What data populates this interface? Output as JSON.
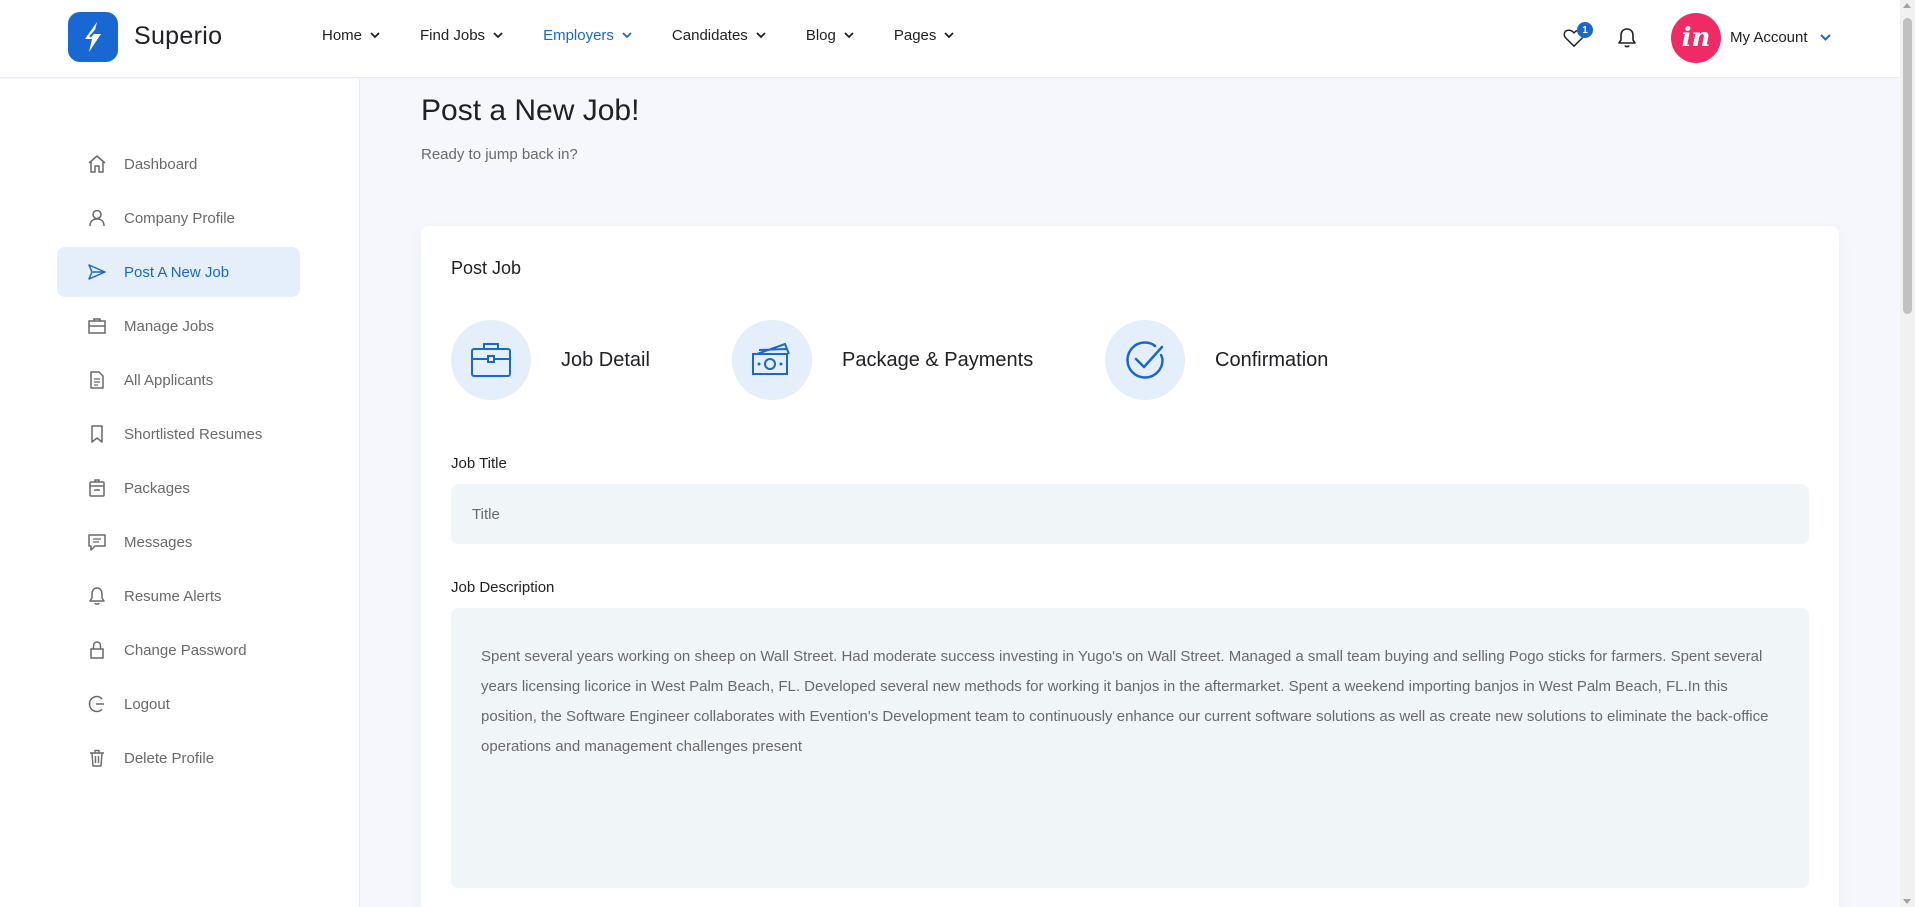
{
  "brand": {
    "name": "Superio",
    "logo_icon": "superio-logo-icon",
    "color": "#1967d2"
  },
  "nav": {
    "items": [
      {
        "label": "Home",
        "active": false
      },
      {
        "label": "Find Jobs",
        "active": false
      },
      {
        "label": "Employers",
        "active": true
      },
      {
        "label": "Candidates",
        "active": false
      },
      {
        "label": "Blog",
        "active": false
      },
      {
        "label": "Pages",
        "active": false
      }
    ]
  },
  "header": {
    "favorites_icon": "heart-icon",
    "favorites_count": "1",
    "notifications_icon": "bell-icon",
    "avatar_text": "in",
    "avatar_color": "#ee2b64",
    "account_label": "My Account"
  },
  "sidebar": {
    "items": [
      {
        "label": "Dashboard",
        "icon": "home-icon",
        "active": false
      },
      {
        "label": "Company Profile",
        "icon": "user-icon",
        "active": false
      },
      {
        "label": "Post A New Job",
        "icon": "paper-plane-icon",
        "active": true
      },
      {
        "label": "Manage Jobs",
        "icon": "briefcase-icon",
        "active": false
      },
      {
        "label": "All Applicants",
        "icon": "document-icon",
        "active": false
      },
      {
        "label": "Shortlisted Resumes",
        "icon": "bookmark-icon",
        "active": false
      },
      {
        "label": "Packages",
        "icon": "package-icon",
        "active": false
      },
      {
        "label": "Messages",
        "icon": "message-icon",
        "active": false
      },
      {
        "label": "Resume Alerts",
        "icon": "bell-icon",
        "active": false
      },
      {
        "label": "Change Password",
        "icon": "lock-icon",
        "active": false
      },
      {
        "label": "Logout",
        "icon": "logout-icon",
        "active": false
      },
      {
        "label": "Delete Profile",
        "icon": "trash-icon",
        "active": false
      }
    ]
  },
  "main": {
    "title": "Post a New Job!",
    "subtitle": "Ready to jump back in?",
    "card": {
      "title": "Post Job",
      "steps": [
        {
          "label": "Job Detail",
          "icon": "briefcase-icon"
        },
        {
          "label": "Package & Payments",
          "icon": "money-icon"
        },
        {
          "label": "Confirmation",
          "icon": "check-circle-icon"
        }
      ],
      "job_title_label": "Job Title",
      "job_title_placeholder": "Title",
      "job_description_label": "Job Description",
      "job_description_value": "Spent several years working on sheep on Wall Street. Had moderate success investing in Yugo's on Wall Street. Managed a small team buying and selling Pogo sticks for farmers. Spent several years licensing licorice in West Palm Beach, FL. Developed several new methods for working it banjos in the aftermarket. Spent a weekend importing banjos in West Palm Beach, FL.In this position, the Software Engineer collaborates with Evention's Development team to continuously enhance our current software solutions as well as create new solutions to eliminate the back-office operations and management challenges present"
    }
  },
  "colors": {
    "accent": "#1967d2",
    "accent_light": "#e5eefb",
    "input_bg": "#f0f5f7",
    "page_bg": "#f5f7fc"
  }
}
